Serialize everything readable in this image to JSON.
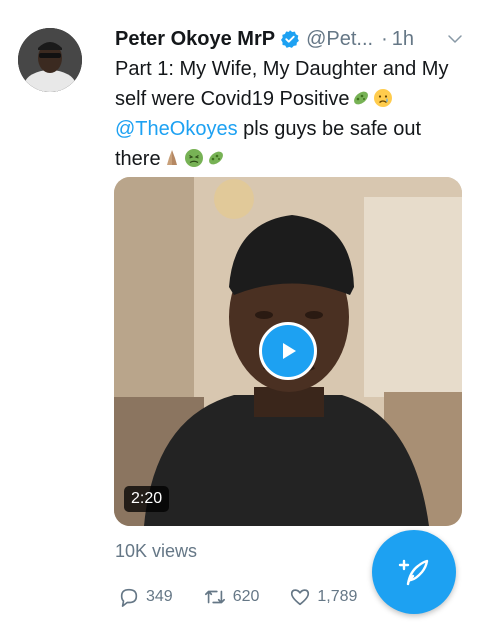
{
  "tweet": {
    "author_name": "Peter Okoye MrP",
    "handle": "@Pet...",
    "separator": "·",
    "time": "1h",
    "text_part1": "Part 1: My Wife, My Daughter and My self were Covid19 Positive",
    "mention": "@TheOkoyes",
    "text_part2": " pls guys be safe out there",
    "video_duration": "2:20",
    "views": "10K views",
    "replies": "349",
    "retweets": "620",
    "likes": "1,789"
  },
  "icons": {
    "verified": "verified-badge-icon",
    "more": "chevron-down-icon",
    "reply": "reply-icon",
    "retweet": "retweet-icon",
    "like": "heart-icon",
    "play": "play-icon",
    "compose": "compose-tweet-icon",
    "emoji_microbe": "microbe-emoji",
    "emoji_crying": "crying-face-emoji",
    "emoji_pray": "folded-hands-emoji",
    "emoji_nauseated": "nauseated-face-emoji"
  },
  "colors": {
    "accent": "#1da1f2",
    "text": "#14171a",
    "secondary": "#657786"
  }
}
